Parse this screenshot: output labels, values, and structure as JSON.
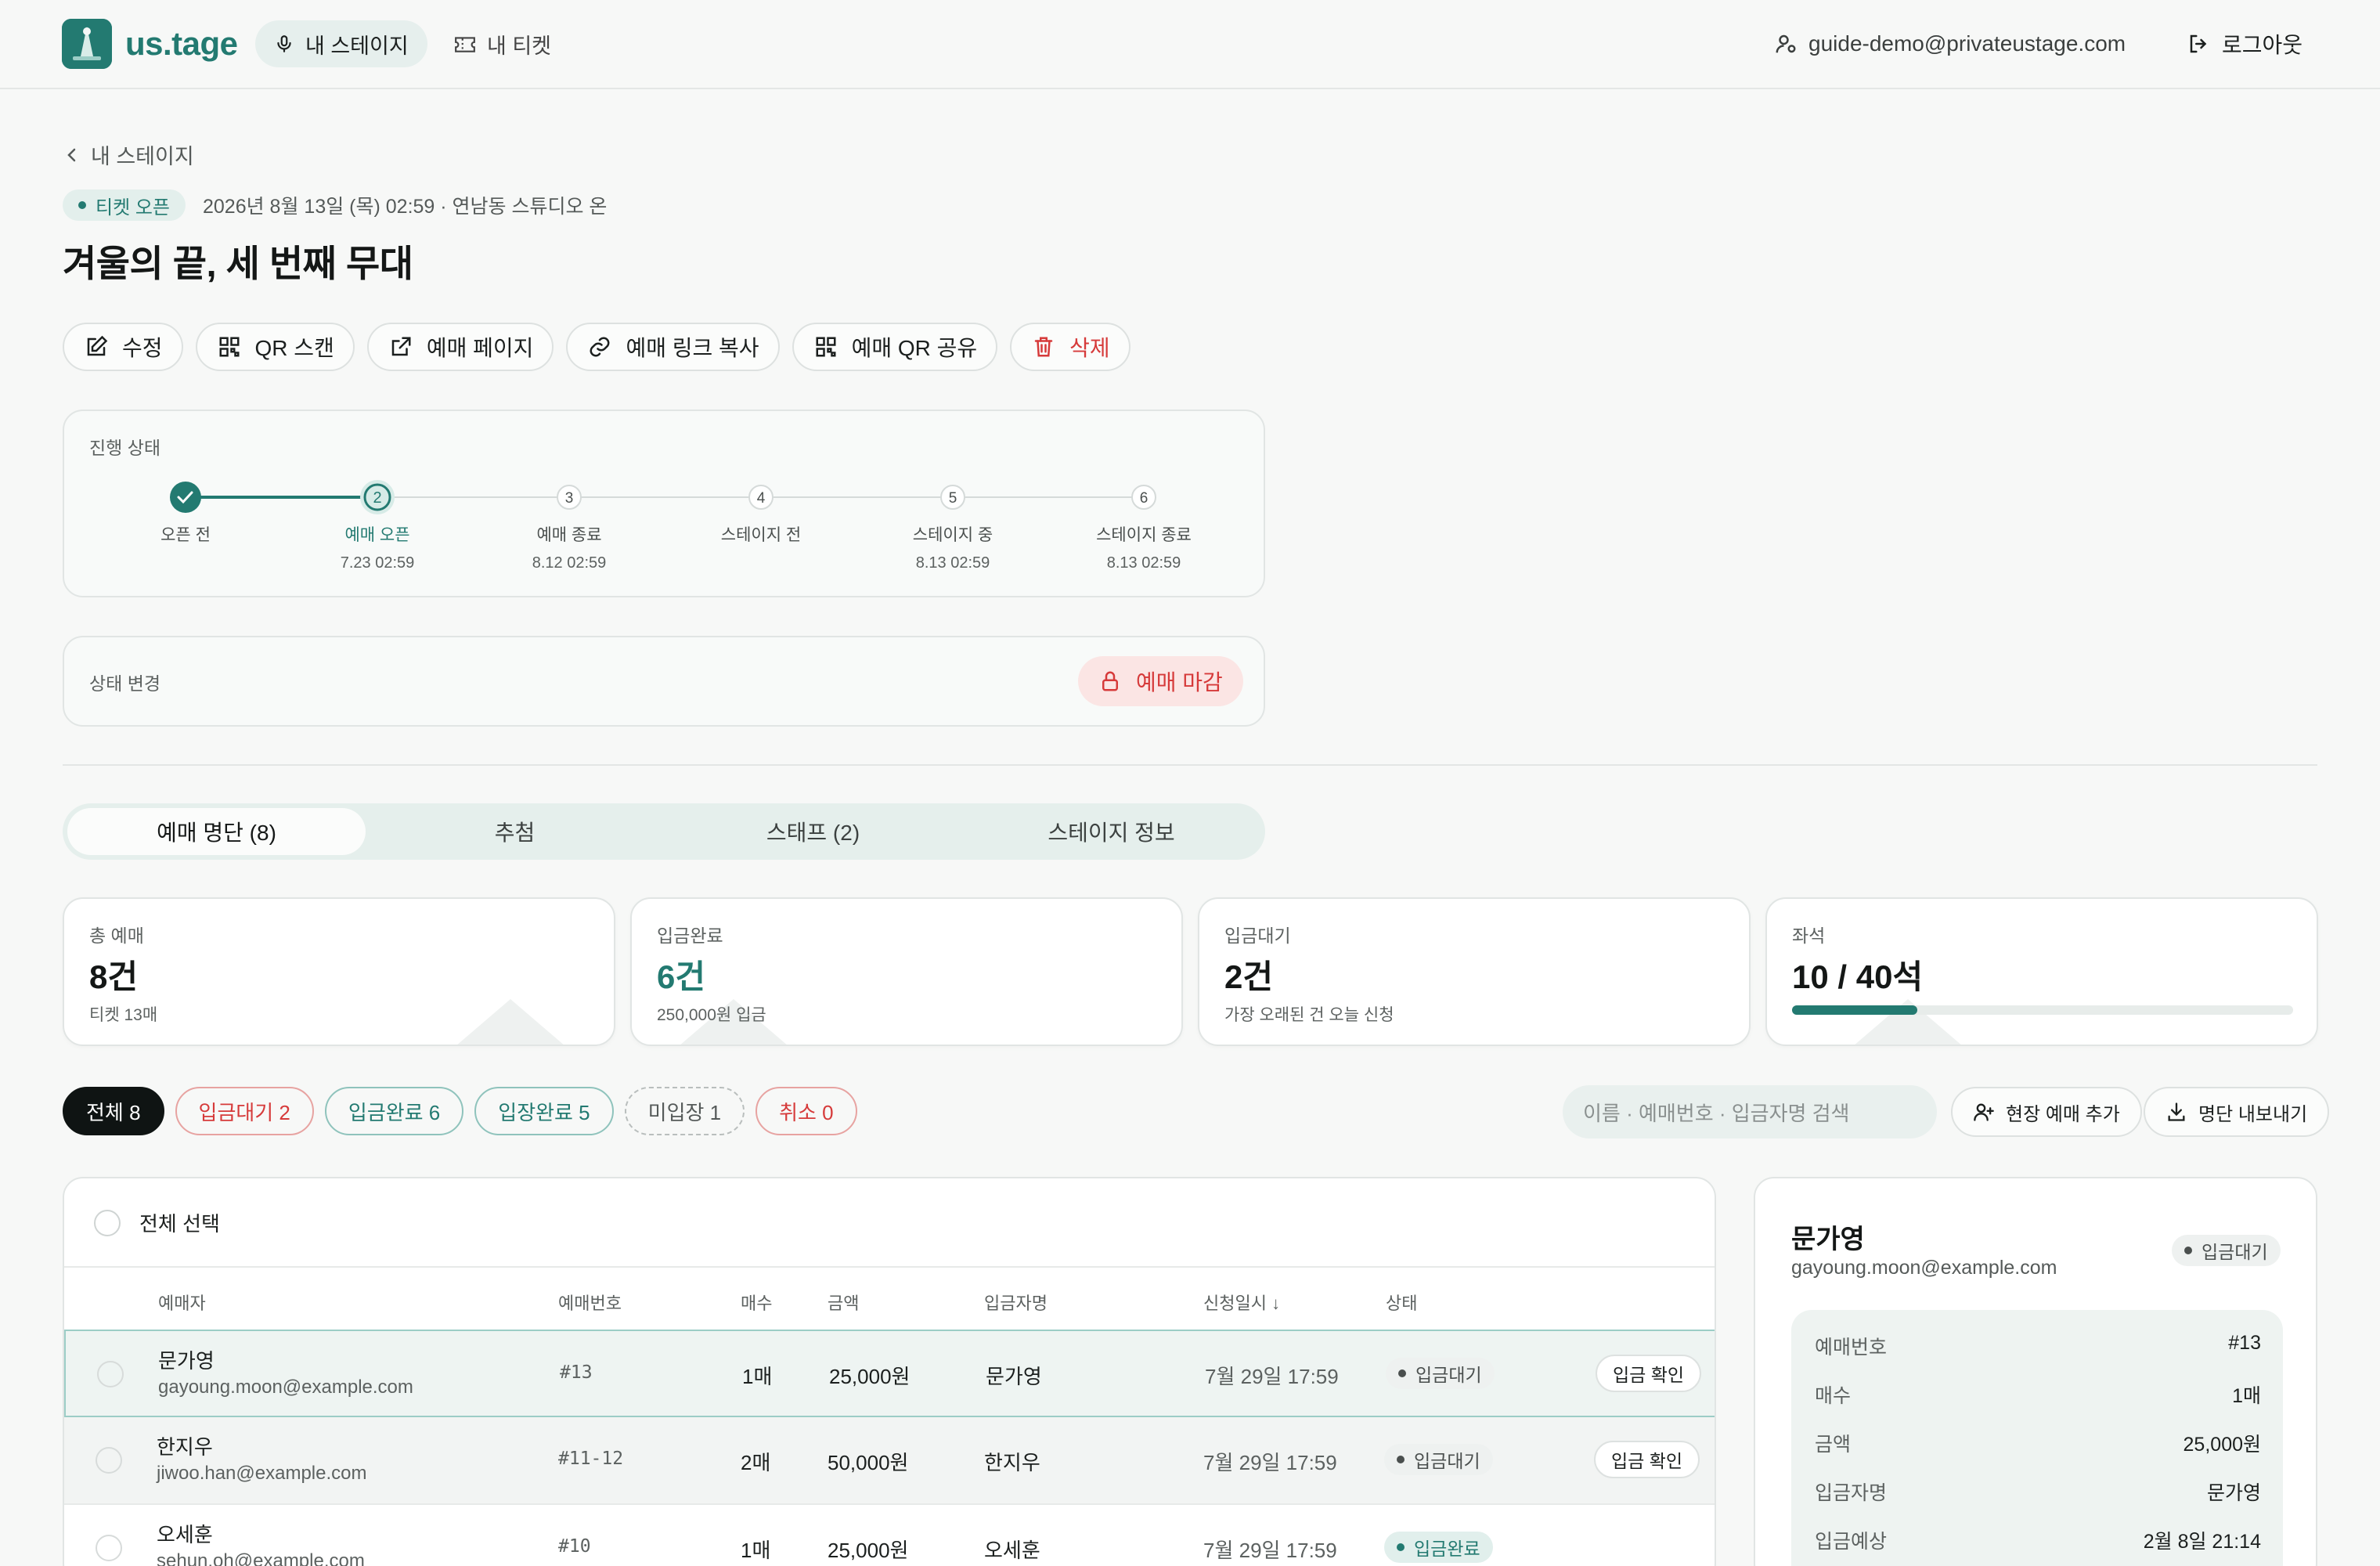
{
  "app": {
    "brand": "us.tage",
    "nav": [
      {
        "label": "내 스테이지",
        "icon": "mic-icon"
      },
      {
        "label": "내 티켓",
        "icon": "ticket-icon"
      }
    ],
    "user_email": "guide-demo@privateustage.com",
    "logout_label": "로그아웃"
  },
  "page": {
    "back_label": "내 스테이지",
    "status_chip": "티켓 오픈",
    "meta": "2026년 8월 13일 (목) 02:59 · 연남동 스튜디오 온",
    "title": "겨울의 끝, 세 번째 무대"
  },
  "actions": [
    {
      "label": "수정",
      "icon": "edit-icon"
    },
    {
      "label": "QR 스캔",
      "icon": "qr-icon"
    },
    {
      "label": "예매 페이지",
      "icon": "external-link-icon"
    },
    {
      "label": "예매 링크 복사",
      "icon": "link-icon"
    },
    {
      "label": "예매 QR 공유",
      "icon": "qr-icon"
    },
    {
      "label": "삭제",
      "icon": "trash-icon"
    }
  ],
  "progress": {
    "label": "진행 상태",
    "current_step": 2,
    "steps": [
      {
        "num": "1",
        "label": "오픈 전",
        "date": ""
      },
      {
        "num": "2",
        "label": "예매 오픈",
        "date": "7.23 02:59"
      },
      {
        "num": "3",
        "label": "예매 종료",
        "date": "8.12 02:59"
      },
      {
        "num": "4",
        "label": "스테이지 전",
        "date": ""
      },
      {
        "num": "5",
        "label": "스테이지 중",
        "date": "8.13 02:59"
      },
      {
        "num": "6",
        "label": "스테이지 종료",
        "date": "8.13 02:59"
      }
    ]
  },
  "status_change": {
    "label": "상태 변경",
    "button": "예매 마감"
  },
  "tabs": [
    {
      "label": "예매 명단 (8)",
      "active": true
    },
    {
      "label": "추첨",
      "active": false
    },
    {
      "label": "스태프 (2)",
      "active": false
    },
    {
      "label": "스테이지 정보",
      "active": false
    }
  ],
  "stats": [
    {
      "label": "총 예매",
      "value": "8건",
      "sub": "티켓 13매"
    },
    {
      "label": "입금완료",
      "value": "6건",
      "sub": "250,000원 입금"
    },
    {
      "label": "입금대기",
      "value": "2건",
      "sub": "가장 오래된 건 오늘 신청"
    },
    {
      "label": "좌석",
      "value": "10 / 40석",
      "sub": "",
      "fill_ratio": 0.25
    }
  ],
  "filters": [
    {
      "label": "전체 8",
      "kind": "all"
    },
    {
      "label": "입금대기 2",
      "kind": "wait"
    },
    {
      "label": "입금완료 6",
      "kind": "paid"
    },
    {
      "label": "입장완료 5",
      "kind": "entered"
    },
    {
      "label": "미입장 1",
      "kind": "noshow"
    },
    {
      "label": "취소 0",
      "kind": "cancel"
    }
  ],
  "search": {
    "placeholder": "이름 · 예매번호 · 입금자명 검색"
  },
  "tools": {
    "add_onsite": "현장 예매 추가",
    "export": "명단 내보내기"
  },
  "table": {
    "select_all": "전체 선택",
    "columns": [
      "예매자",
      "예매번호",
      "매수",
      "금액",
      "입금자명",
      "신청일시 ↓",
      "상태"
    ],
    "rows": [
      {
        "name": "문가영",
        "email": "gayoung.moon@example.com",
        "no": "#13",
        "qty": "1매",
        "amount": "25,000원",
        "payer": "문가영",
        "date": "7월 29일 17:59",
        "status": "입금대기",
        "status_kind": "wait",
        "action": "입금 확인"
      },
      {
        "name": "한지우",
        "email": "jiwoo.han@example.com",
        "no": "#11-12",
        "qty": "2매",
        "amount": "50,000원",
        "payer": "한지우",
        "date": "7월 29일 17:59",
        "status": "입금대기",
        "status_kind": "wait",
        "action": "입금 확인"
      },
      {
        "name": "오세훈",
        "email": "sehun.oh@example.com",
        "no": "#10",
        "qty": "1매",
        "amount": "25,000원",
        "payer": "오세훈",
        "date": "7월 29일 17:59",
        "status": "입금완료",
        "status_kind": "paid",
        "action": ""
      }
    ]
  },
  "detail": {
    "name": "문가영",
    "email": "gayoung.moon@example.com",
    "status": "입금대기",
    "fields": [
      {
        "k": "예매번호",
        "v": "#13"
      },
      {
        "k": "매수",
        "v": "1매"
      },
      {
        "k": "금액",
        "v": "25,000원"
      },
      {
        "k": "입금자명",
        "v": "문가영"
      },
      {
        "k": "입금예상",
        "v": "2월 8일 21:14"
      }
    ]
  },
  "colors": {
    "accent": "#237a71",
    "danger": "#d63a3a",
    "bg": "#f7f8f7"
  }
}
